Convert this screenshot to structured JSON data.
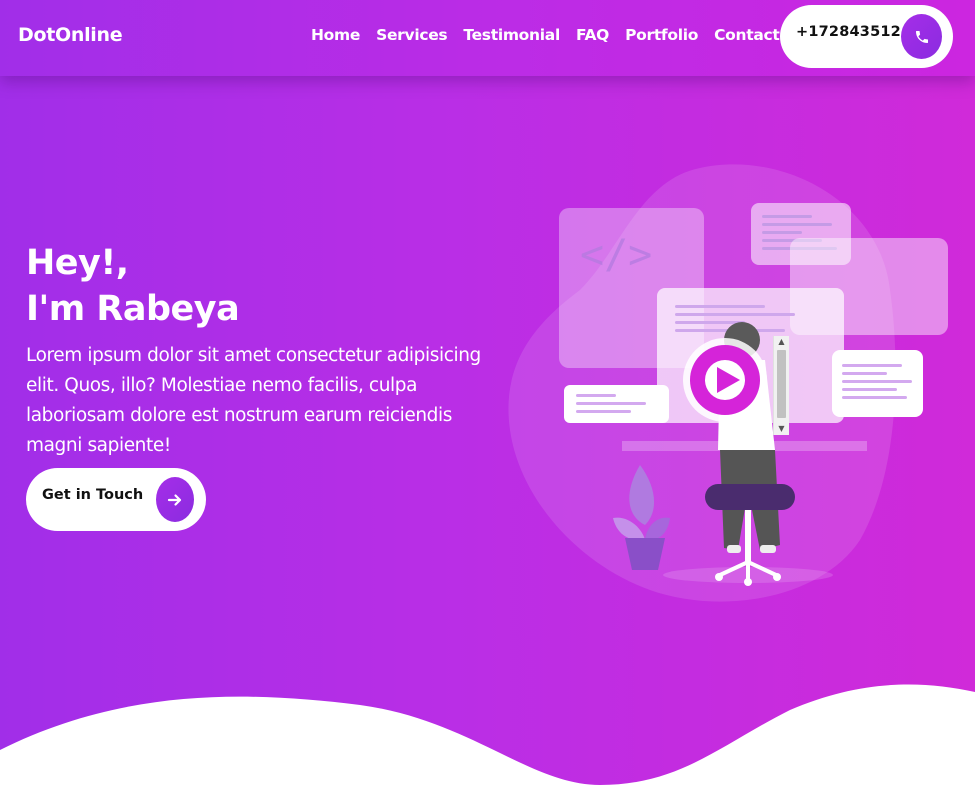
{
  "header": {
    "brand": "DotOnline",
    "nav": [
      {
        "label": "Home"
      },
      {
        "label": "Services"
      },
      {
        "label": "Testimonial"
      },
      {
        "label": "FAQ"
      },
      {
        "label": "Portfolio"
      },
      {
        "label": "Contact"
      }
    ],
    "phone": "+172843512",
    "phone_icon": "phone-icon"
  },
  "hero": {
    "greeting": "Hey!,",
    "name_line": "I'm Rabeya",
    "description": "Lorem ipsum dolor sit amet consectetur adipisicing elit. Quos, illo? Molestiae nemo facilis, culpa laboriosam dolore est nostrum earum reiciendis magni sapiente!",
    "cta_label": "Get in Touch",
    "cta_icon": "arrow-right-icon",
    "code_symbol": "</>",
    "play_icon": "play-icon"
  },
  "colors": {
    "gradient_start": "#a12ee8",
    "gradient_end": "#d02ad9",
    "accent": "#9b2de6",
    "play_button": "#d524d9"
  }
}
